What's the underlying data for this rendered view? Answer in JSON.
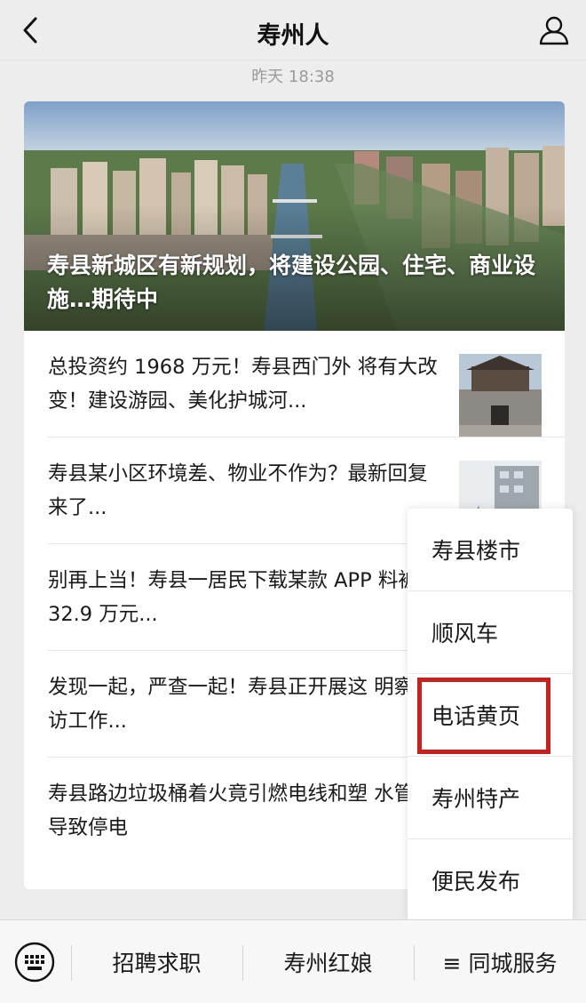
{
  "header": {
    "title": "寿州人",
    "back_icon": "chevron-left-icon",
    "profile_icon": "user-icon"
  },
  "timestamp": "昨天 18:38",
  "hero": {
    "title": "寿县新城区有新规划，将建设公园、住宅、商业设施…期待中"
  },
  "articles": [
    {
      "title": "总投资约 1968 万元！寿县西门外 将有大改变！建设游园、美化护城河..."
    },
    {
      "title": "寿县某小区环境差、物业不作为？最新回复来了..."
    },
    {
      "title": "别再上当！寿县一居民下载某款 APP 料被骗 32.9 万元..."
    },
    {
      "title": "发现一起，严查一起！寿县正开展这 明察暗访工作..."
    },
    {
      "title": "寿县路边垃圾桶着火竟引燃电线和塑 水管...导致停电"
    }
  ],
  "popup_menu": {
    "items": [
      "寿县楼市",
      "顺风车",
      "电话黄页",
      "寿州特产",
      "便民发布"
    ],
    "highlighted_index": 2,
    "highlight_color": "#c8201c"
  },
  "bottom_bar": {
    "keyboard_icon": "keyboard-icon",
    "tabs": [
      "招聘求职",
      "寿州红娘",
      "≡ 同城服务"
    ]
  }
}
